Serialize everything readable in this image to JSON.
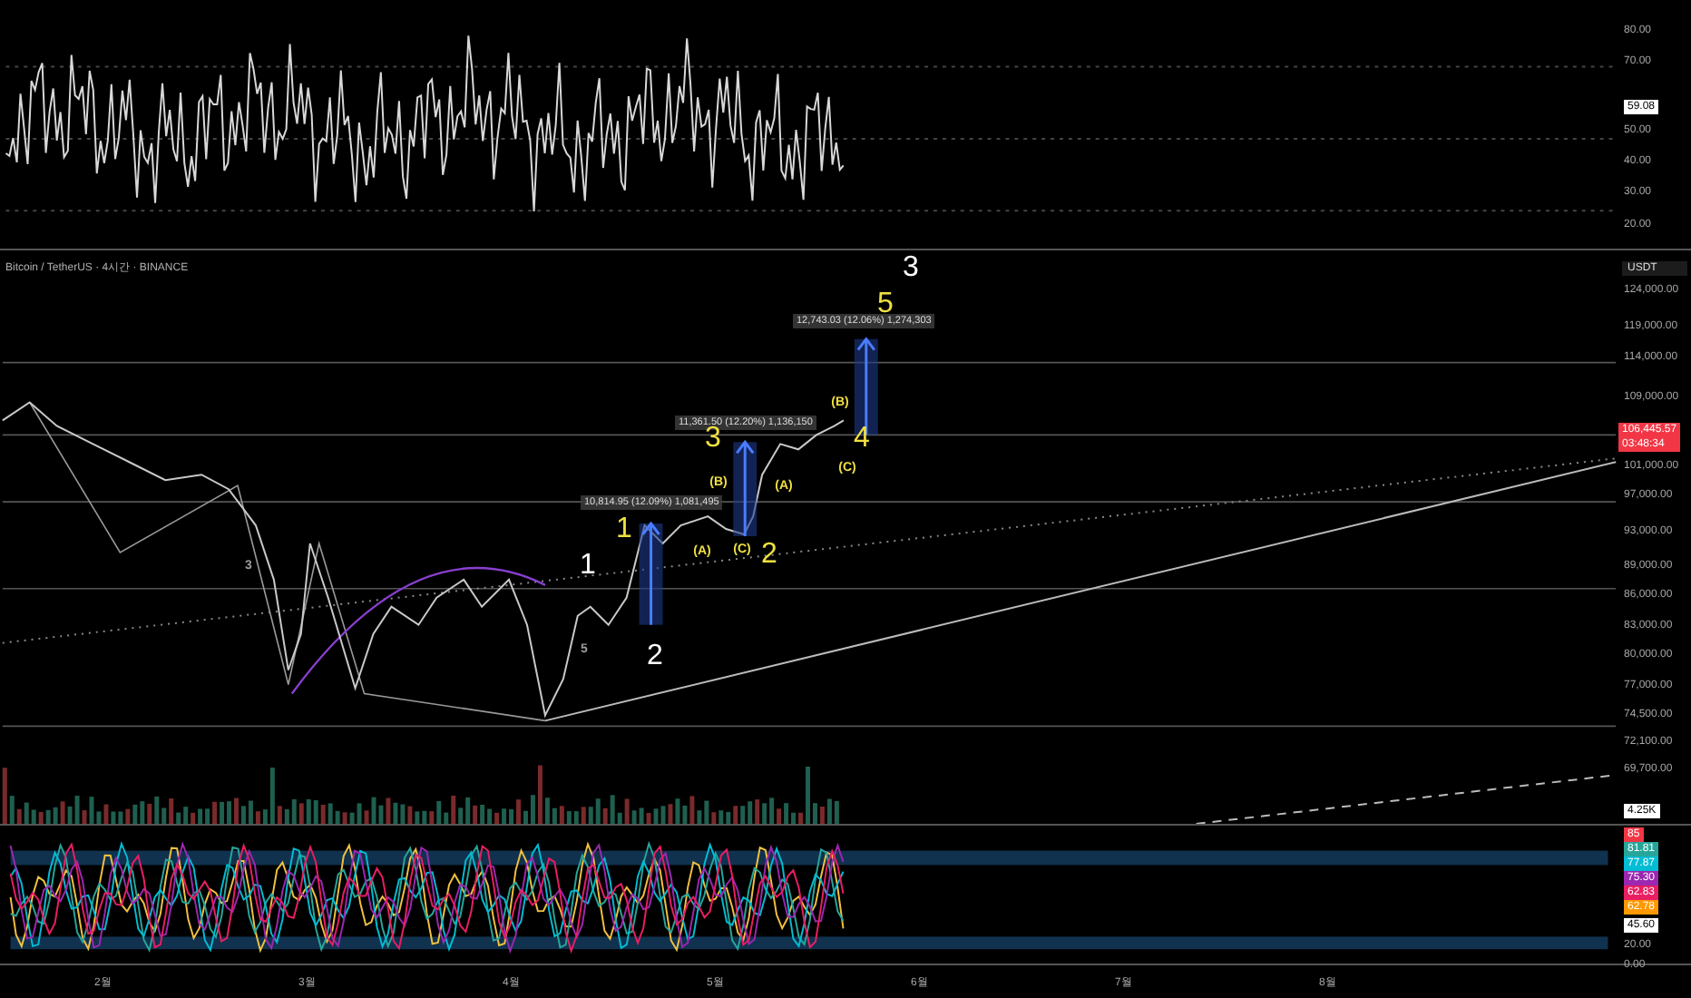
{
  "rsi_pane": {
    "axis_ticks": [
      "80.00",
      "70.00",
      "50.00",
      "40.00",
      "30.00",
      "20.00"
    ],
    "value_badge": "59.08"
  },
  "main_pane": {
    "legend": "Bitcoin / TetherUS · 4시간 · BINANCE",
    "currency": "USDT",
    "axis_ticks": [
      "124,000.00",
      "119,000.00",
      "114,000.00",
      "109,000.00",
      "101,000.00",
      "97,000.00",
      "93,000.00",
      "89,000.00",
      "86,000.00",
      "83,000.00",
      "80,000.00",
      "77,000.00",
      "74,500.00",
      "72,100.00",
      "69,700.00"
    ],
    "price_badge": {
      "price": "106,445.57",
      "countdown": "03:48:34"
    },
    "volume_badge": "4.25K",
    "measurements": [
      "12,743.03 (12.06%) 1,274,303",
      "11,361.50 (12.20%) 1,136,150",
      "10,814.95 (12.09%) 1,081,495"
    ],
    "wave_labels": [
      {
        "text": "3",
        "color": "#ffffff",
        "kind": "big"
      },
      {
        "text": "5",
        "color": "#f0e040",
        "kind": "big"
      },
      {
        "text": "3",
        "color": "#f0e040",
        "kind": "big"
      },
      {
        "text": "4",
        "color": "#f0e040",
        "kind": "big"
      },
      {
        "text": "1",
        "color": "#f0e040",
        "kind": "big"
      },
      {
        "text": "2",
        "color": "#f0e040",
        "kind": "big"
      },
      {
        "text": "1",
        "color": "#ffffff",
        "kind": "big"
      },
      {
        "text": "2",
        "color": "#ffffff",
        "kind": "big"
      },
      {
        "text": "(B)",
        "color": "#f0e040",
        "kind": "small"
      },
      {
        "text": "(A)",
        "color": "#f0e040",
        "kind": "small"
      },
      {
        "text": "(C)",
        "color": "#f0e040",
        "kind": "small"
      },
      {
        "text": "(A)",
        "color": "#f0e040",
        "kind": "small"
      },
      {
        "text": "(C)",
        "color": "#f0e040",
        "kind": "small"
      },
      {
        "text": "(B)",
        "color": "#f0e040",
        "kind": "small"
      },
      {
        "text": "3",
        "color": "#9a9a9a",
        "kind": "small"
      },
      {
        "text": "5",
        "color": "#9a9a9a",
        "kind": "small"
      }
    ]
  },
  "stoch_pane": {
    "badges": [
      {
        "text": "85",
        "color": "#f23645"
      },
      {
        "text": "81.81",
        "color": "#26a69a"
      },
      {
        "text": "77.87",
        "color": "#00bcd4"
      },
      {
        "text": "75.30",
        "color": "#9c27b0"
      },
      {
        "text": "62.83",
        "color": "#e91e63"
      },
      {
        "text": "62.78",
        "color": "#ff9800"
      }
    ],
    "value_badge": "45.60",
    "axis_ticks": [
      "20.00",
      "0.00"
    ]
  },
  "time_axis": [
    "2월",
    "3월",
    "4월",
    "5월",
    "6월",
    "7월",
    "8월"
  ]
}
